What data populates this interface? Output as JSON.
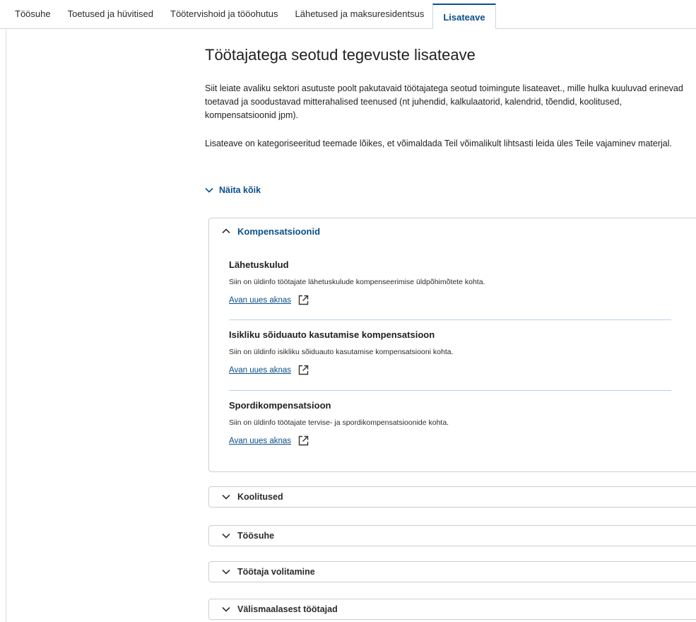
{
  "tabs": [
    {
      "label": "Töösuhe"
    },
    {
      "label": "Toetused ja hüvitised"
    },
    {
      "label": "Töötervishoid ja tööohutus"
    },
    {
      "label": "Lähetused ja maksuresidentsus"
    },
    {
      "label": "Lisateave"
    }
  ],
  "page": {
    "title": "Töötajatega seotud tegevuste lisateave",
    "intro_1": "Siit leiate avaliku sektori asutuste poolt pakutavaid töötajatega seotud toimingute lisateavet., mille hulka kuuluvad erinevad toetavad ja soodustavad mitterahalised teenused (nt juhendid, kalkulaatorid, kalendrid, tõendid, koolitused, kompensatsioonid jpm).",
    "intro_2": "Lisateave on kategoriseeritud teemade lõikes, et võimaldada Teil võimalikult lihtsasti leida üles Teile vajaminev materjal.",
    "show_all": "Näita kõik"
  },
  "open_section": {
    "label": "Kompensatsioonid",
    "items": [
      {
        "title": "Lähetuskulud",
        "text": "Siin on üldinfo töötajate lähetuskulude kompenseerimise üldpõhimõtete kohta.",
        "link": "Avan uues aknas"
      },
      {
        "title": "Isikliku sõiduauto kasutamise kompensatsioon",
        "text": "Siin on üldinfo isikliku sõiduauto kasutamise kompensatsiooni kohta.",
        "link": "Avan uues aknas"
      },
      {
        "title": "Spordikompensatsioon",
        "text": "Siin on üldinfo töötajate tervise- ja spordikompensatsioonide kohta.",
        "link": "Avan uues aknas"
      }
    ]
  },
  "sections": [
    {
      "label": "Koolitused"
    },
    {
      "label": "Töösuhe"
    },
    {
      "label": "Töötaja volitamine"
    },
    {
      "label": "Välismaalasest töötajad"
    }
  ],
  "colors": {
    "accent": "#0b4f8a",
    "border": "#c9ced4",
    "divider": "#b7cfe3"
  }
}
